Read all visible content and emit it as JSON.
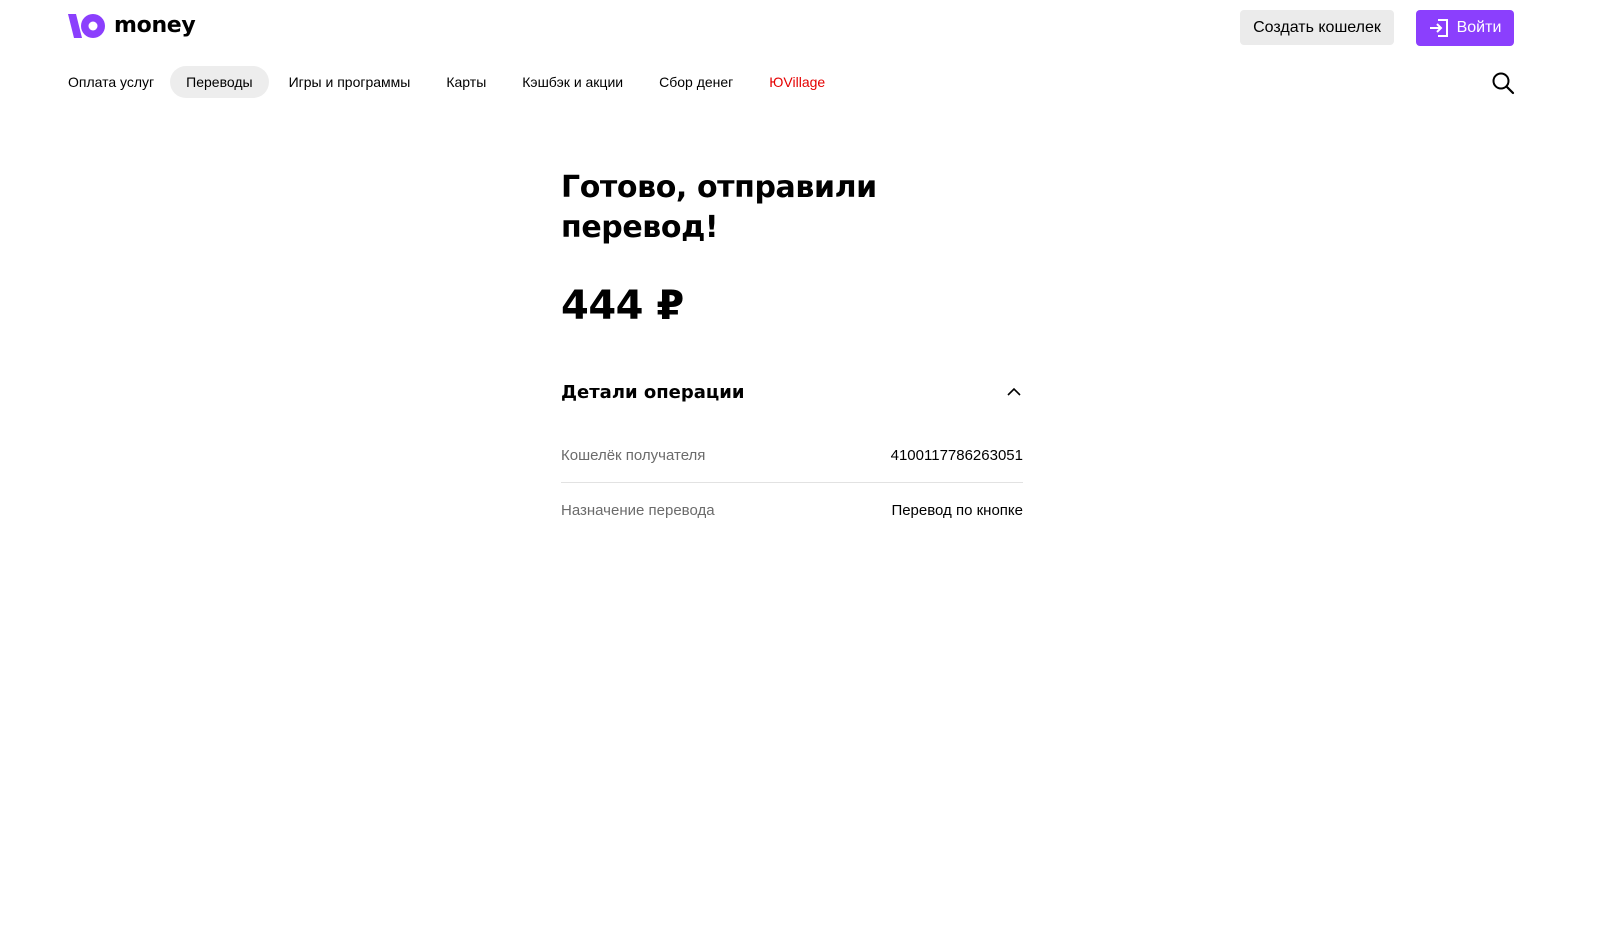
{
  "brand": {
    "name": "money",
    "color": "#8b3ffd"
  },
  "header": {
    "create_wallet_label": "Создать кошелек",
    "login_label": "Войти"
  },
  "nav": {
    "items": [
      {
        "label": "Оплата услуг"
      },
      {
        "label": "Переводы",
        "active": true
      },
      {
        "label": "Игры и программы"
      },
      {
        "label": "Карты"
      },
      {
        "label": "Кэшбэк и акции"
      },
      {
        "label": "Сбор денег"
      },
      {
        "label": "ЮVillage",
        "accent_color": "#e50000"
      }
    ],
    "search_icon": "search-icon"
  },
  "result": {
    "title": "Готово, отправили перевод!",
    "amount": "444 ₽"
  },
  "details": {
    "title": "Детали операции",
    "expanded": true,
    "rows": [
      {
        "label": "Кошелёк получателя",
        "value": "4100117786263051"
      },
      {
        "label": "Назначение перевода",
        "value": "Перевод по кнопке"
      }
    ]
  }
}
